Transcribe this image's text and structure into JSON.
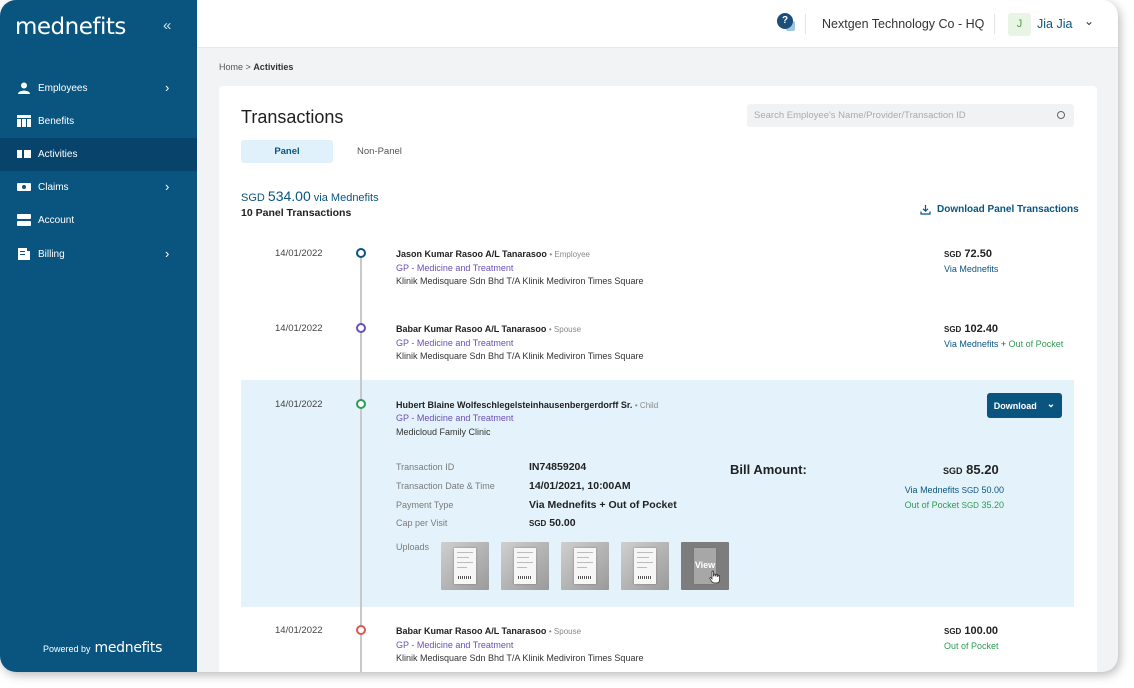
{
  "sidebar": {
    "logo": "mednefits",
    "collapse": "«",
    "items": [
      {
        "label": "Employees",
        "chevron": "›"
      },
      {
        "label": "Benefits"
      },
      {
        "label": "Activities"
      },
      {
        "label": "Claims",
        "chevron": "›"
      },
      {
        "label": "Account"
      },
      {
        "label": "Billing",
        "chevron": "›"
      }
    ],
    "powered_by": "Powered by",
    "powered_brand": "mednefits"
  },
  "topbar": {
    "help": "?",
    "company": "Nextgen Technology Co - HQ",
    "avatar_initial": "J",
    "user_name": "Jia Jia",
    "user_chevron": "⌄"
  },
  "breadcrumb": {
    "home": "Home",
    "sep": ">",
    "current": "Activities"
  },
  "page": {
    "title": "Transactions",
    "search_placeholder": "Search Employee's Name/Provider/Transaction ID",
    "tabs": {
      "panel": "Panel",
      "non_panel": "Non-Panel"
    },
    "summary_currency": "SGD",
    "summary_amount": "534.00",
    "summary_via": "via Mednefits",
    "summary_count": "10 Panel Transactions",
    "download_label": "Download Panel Transactions"
  },
  "transactions": [
    {
      "date": "14/01/2022",
      "name": "Jason Kumar Rasoo A/L Tanarasoo",
      "relation": "• Employee",
      "category": "GP - Medicine and Treatment",
      "provider": "Klinik Medisquare Sdn Bhd T/A Klinik Mediviron Times Square",
      "currency": "SGD",
      "amount": "72.50",
      "via": "Via Mednefits",
      "via_plus": "",
      "via_oop": "",
      "dot_color": "#0a5580"
    },
    {
      "date": "14/01/2022",
      "name": "Babar Kumar Rasoo A/L Tanarasoo",
      "relation": "• Spouse",
      "category": "GP - Medicine and Treatment",
      "provider": "Klinik Medisquare Sdn Bhd T/A Klinik Mediviron Times Square",
      "currency": "SGD",
      "amount": "102.40",
      "via": "Via Mednefits",
      "via_plus": "+",
      "via_oop": "Out of Pocket",
      "dot_color": "#6a4fb5"
    },
    {
      "date": "14/01/2022",
      "name": "Hubert Blaine Wolfeschlegelsteinhausenbergerdorff Sr.",
      "relation": "• Child",
      "category": "GP - Medicine and Treatment",
      "provider": "Medicloud Family Clinic",
      "dot_color": "#2f9a53"
    },
    {
      "date": "14/01/2022",
      "name": "Babar Kumar Rasoo A/L Tanarasoo",
      "relation": "• Spouse",
      "category": "GP - Medicine and Treatment",
      "provider": "Klinik Medisquare Sdn Bhd T/A Klinik Mediviron Times Square",
      "currency": "SGD",
      "amount": "100.00",
      "via": "",
      "via_plus": "",
      "via_oop": "Out of Pocket",
      "dot_color": "#e0564f"
    }
  ],
  "expanded": {
    "download_button": "Download",
    "download_chevron": "⌄",
    "labels": {
      "transaction_id": "Transaction ID",
      "date_time": "Transaction Date & Time",
      "payment_type": "Payment Type",
      "cap": "Cap per Visit",
      "uploads": "Uploads"
    },
    "values": {
      "transaction_id": "IN74859204",
      "date_time": "14/01/2021, 10:00AM",
      "payment_type": "Via Mednefits + Out of Pocket",
      "cap_currency": "SGD",
      "cap_amount": "50.00"
    },
    "bill_label": "Bill Amount:",
    "bill_currency": "SGD",
    "bill_amount": "85.20",
    "bill_via_label": "Via Mednefits",
    "bill_via_currency": "SGD",
    "bill_via_amount": "50.00",
    "bill_oop_label": "Out of Pocket",
    "bill_oop_currency": "SGD",
    "bill_oop_amount": "35.20",
    "view_label": "View"
  },
  "colors": {
    "sidebar_bg": "#0a5580",
    "sidebar_active": "#07436a",
    "accent": "#0a5580",
    "category": "#6a4fb5",
    "out_of_pocket": "#2f9a53",
    "expanded_bg": "#e4f3fb"
  }
}
